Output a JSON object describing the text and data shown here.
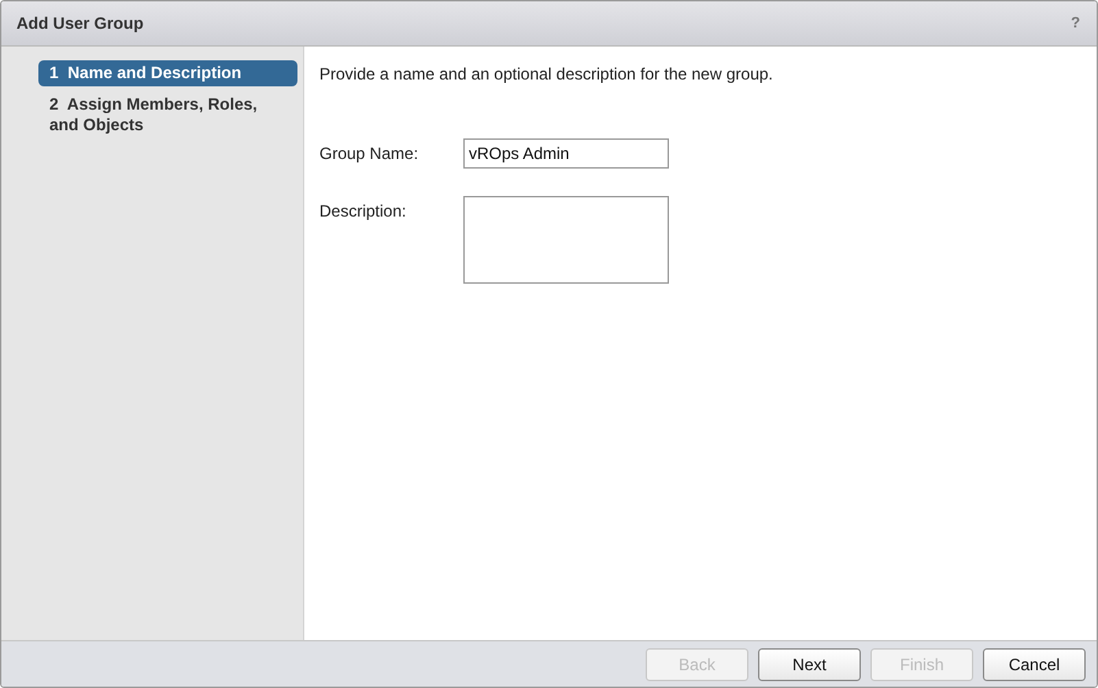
{
  "window": {
    "title": "Add User Group",
    "help": "?"
  },
  "steps": [
    {
      "number": "1",
      "label": "Name and Description",
      "selected": true
    },
    {
      "number": "2",
      "label": "Assign Members, Roles, and Objects",
      "selected": false
    }
  ],
  "intro": "Provide a name and an optional description for the new group.",
  "fields": [
    {
      "kind": "text",
      "label": "Group Name:",
      "value": "vROps Admin"
    },
    {
      "kind": "textarea",
      "label": "Description:"
    }
  ],
  "buttons": [
    {
      "label": "Back",
      "disabled": true
    },
    {
      "label": "Next",
      "disabled": false
    },
    {
      "label": "Finish",
      "disabled": true
    },
    {
      "label": "Cancel",
      "disabled": false
    }
  ]
}
